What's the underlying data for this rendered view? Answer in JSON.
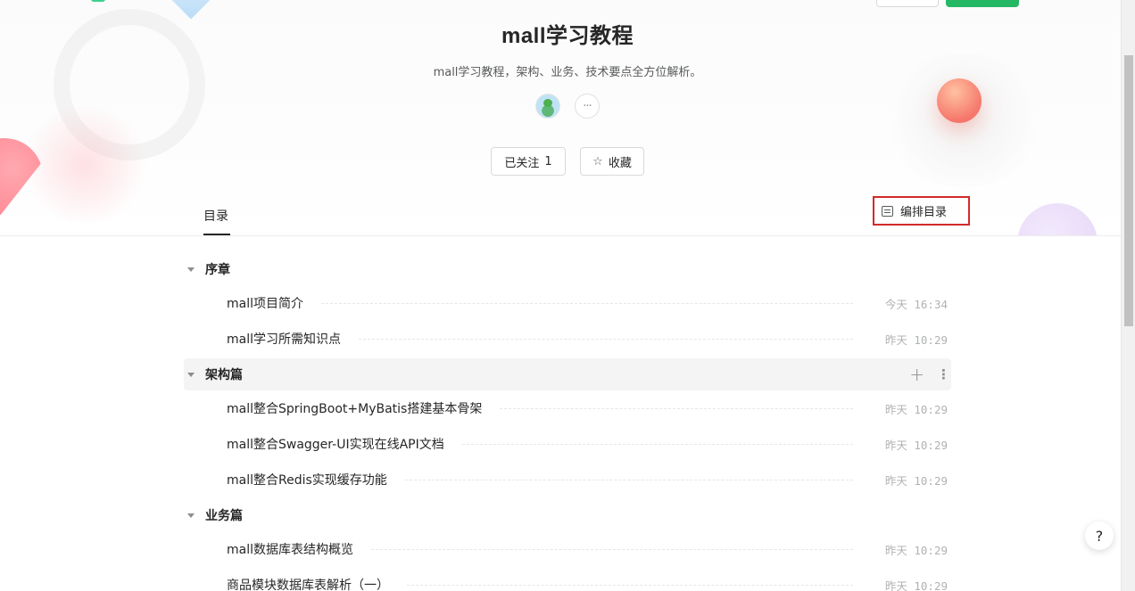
{
  "book": {
    "title": "mall学习教程",
    "description": "mall学习教程，架构、业务、技术要点全方位解析。",
    "more_label": "···"
  },
  "actions": {
    "follow_label": "已关注",
    "follow_count": "1",
    "collect_label": "收藏"
  },
  "tabs": {
    "toc_label": "目录",
    "arrange_label": "编排目录"
  },
  "toc": {
    "sections": [
      {
        "title": "序章",
        "docs": [
          {
            "title": "mall项目简介",
            "date": "今天 16:34"
          },
          {
            "title": "mall学习所需知识点",
            "date": "昨天 10:29"
          }
        ]
      },
      {
        "title": "架构篇",
        "docs": [
          {
            "title": "mall整合SpringBoot+MyBatis搭建基本骨架",
            "date": "昨天 10:29"
          },
          {
            "title": "mall整合Swagger-UI实现在线API文档",
            "date": "昨天 10:29"
          },
          {
            "title": "mall整合Redis实现缓存功能",
            "date": "昨天 10:29"
          }
        ]
      },
      {
        "title": "业务篇",
        "docs": [
          {
            "title": "mall数据库表结构概览",
            "date": "昨天 10:29"
          },
          {
            "title": "商品模块数据库表解析（一）",
            "date": "昨天 10:29"
          }
        ]
      }
    ]
  },
  "help": {
    "label": "?"
  },
  "icons": {
    "collect": "star-icon",
    "arrange": "list-icon",
    "add": "plus-icon",
    "more": "vertical-dots-icon",
    "help": "help-icon"
  },
  "colors": {
    "accent_green": "#25b864",
    "highlight_border": "#d12a2a",
    "text": "#262626",
    "muted": "#b0b3b2"
  }
}
